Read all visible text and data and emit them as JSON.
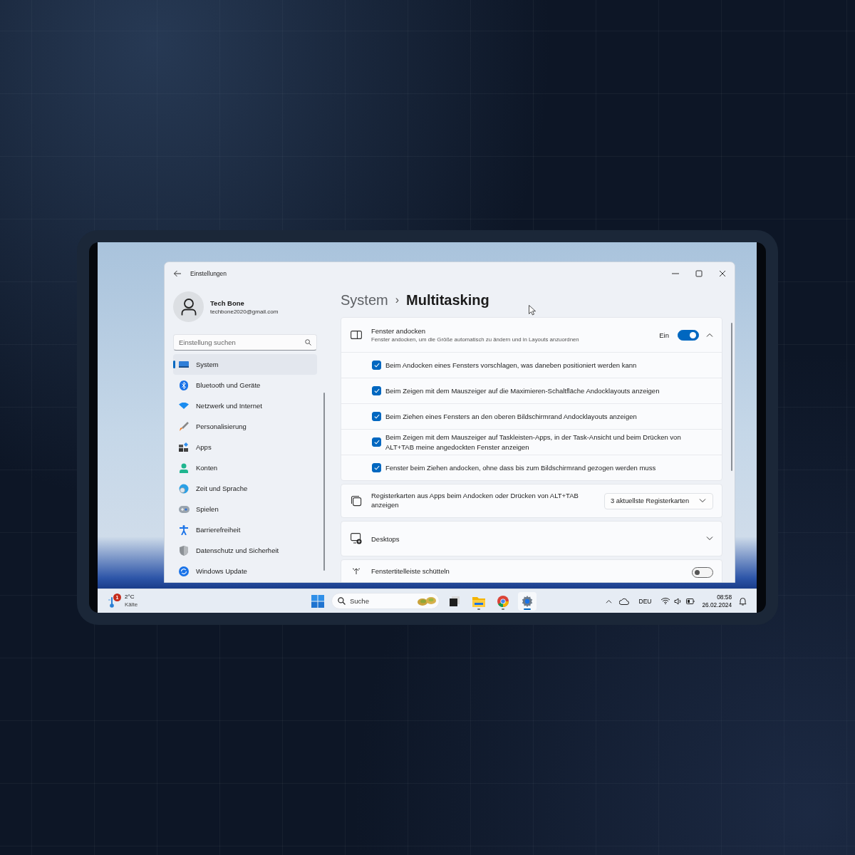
{
  "window": {
    "title": "Einstellungen"
  },
  "profile": {
    "name": "Tech Bone",
    "email": "techbone2020@gmail.com"
  },
  "search": {
    "placeholder": "Einstellung suchen"
  },
  "nav": [
    {
      "label": "System",
      "selected": true
    },
    {
      "label": "Bluetooth und Geräte",
      "selected": false
    },
    {
      "label": "Netzwerk und Internet",
      "selected": false
    },
    {
      "label": "Personalisierung",
      "selected": false
    },
    {
      "label": "Apps",
      "selected": false
    },
    {
      "label": "Konten",
      "selected": false
    },
    {
      "label": "Zeit und Sprache",
      "selected": false
    },
    {
      "label": "Spielen",
      "selected": false
    },
    {
      "label": "Barrierefreiheit",
      "selected": false
    },
    {
      "label": "Datenschutz und Sicherheit",
      "selected": false
    },
    {
      "label": "Windows Update",
      "selected": false
    }
  ],
  "breadcrumb": {
    "parent": "System",
    "separator": "›",
    "current": "Multitasking"
  },
  "cards": [
    {
      "kind": "expander",
      "title": "Fenster andocken",
      "description": "Fenster andocken, um die Größe automatisch zu ändern und in Layouts anzuordnen",
      "toggle_label": "Ein",
      "on": true,
      "expanded": true,
      "options": [
        {
          "label": "Beim Andocken eines Fensters vorschlagen, was daneben positioniert werden kann",
          "checked": true
        },
        {
          "label": "Beim Zeigen mit dem Mauszeiger auf die Maximieren-Schaltfläche Andocklayouts anzeigen",
          "checked": true
        },
        {
          "label": "Beim Ziehen eines Fensters an den oberen Bildschirmrand Andocklayouts anzeigen",
          "checked": true
        },
        {
          "label": "Beim Zeigen mit dem Mauszeiger auf Taskleisten-Apps, in der Task-Ansicht und beim Drücken von ALT+TAB meine angedockten Fenster anzeigen",
          "checked": true
        },
        {
          "label": "Fenster beim Ziehen andocken, ohne dass bis zum Bildschirmrand gezogen werden muss",
          "checked": true
        }
      ]
    },
    {
      "kind": "dropdown",
      "title": "Registerkarten aus Apps beim Andocken oder Drücken von ALT+TAB anzeigen",
      "value": "3 aktuellste Registerkarten"
    },
    {
      "kind": "expander",
      "title": "Desktops",
      "expanded": false
    },
    {
      "kind": "toggle",
      "title": "Fenstertitelleiste schütteln",
      "on": false
    }
  ],
  "taskbar": {
    "weather": {
      "badge": "1",
      "temperature": "2°C",
      "condition": "Kälte"
    },
    "search": {
      "placeholder": "Suche"
    },
    "apps": [
      {
        "running": false,
        "selected": false
      },
      {
        "running": true,
        "selected": false
      },
      {
        "running": true,
        "selected": false
      },
      {
        "running": true,
        "selected": true
      }
    ],
    "language": "DEU",
    "time": "08:58",
    "date": "26.02.2024"
  }
}
